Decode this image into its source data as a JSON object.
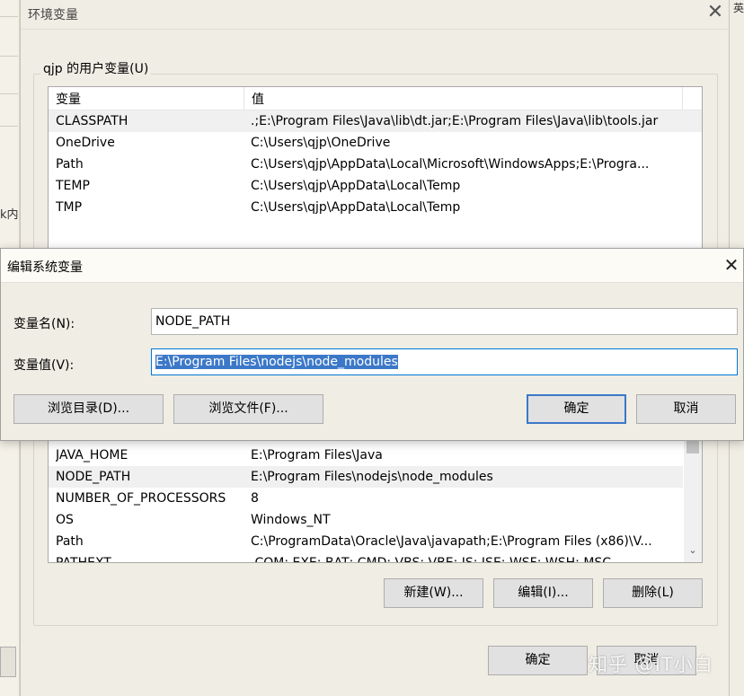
{
  "env_window": {
    "title": "环境变量",
    "user_group_label": "qjp 的用户变量(U)",
    "columns": [
      "变量",
      "值"
    ],
    "user_vars": [
      {
        "name": "CLASSPATH",
        "value": ".;E:\\Program Files\\Java\\lib\\dt.jar;E:\\Program Files\\Java\\lib\\tools.jar"
      },
      {
        "name": "OneDrive",
        "value": "C:\\Users\\qjp\\OneDrive"
      },
      {
        "name": "Path",
        "value": "C:\\Users\\qjp\\AppData\\Local\\Microsoft\\WindowsApps;E:\\Progra..."
      },
      {
        "name": "TEMP",
        "value": "C:\\Users\\qjp\\AppData\\Local\\Temp"
      },
      {
        "name": "TMP",
        "value": "C:\\Users\\qjp\\AppData\\Local\\Temp"
      }
    ],
    "system_vars": [
      {
        "name": "JAVA_HOME",
        "value": "E:\\Program Files\\Java"
      },
      {
        "name": "NODE_PATH",
        "value": "E:\\Program Files\\nodejs\\node_modules"
      },
      {
        "name": "NUMBER_OF_PROCESSORS",
        "value": "8"
      },
      {
        "name": "OS",
        "value": "Windows_NT"
      },
      {
        "name": "Path",
        "value": "C:\\ProgramData\\Oracle\\Java\\javapath;E:\\Program Files (x86)\\V..."
      },
      {
        "name": "PATHEXT",
        "value": ".COM;.EXE;.BAT;.CMD;.VBS;.VBE;.JS;.JSE;.WSF;.WSH;.MSC"
      }
    ],
    "buttons": {
      "new": "新建(W)...",
      "edit": "编辑(I)...",
      "delete": "删除(L)",
      "ok": "确定",
      "cancel": "取消"
    }
  },
  "edit_dialog": {
    "title": "编辑系统变量",
    "name_label": "变量名(N):",
    "name_value": "NODE_PATH",
    "value_label": "变量值(V):",
    "value_value": "E:\\Program Files\\nodejs\\node_modules",
    "buttons": {
      "browse_dir": "浏览目录(D)...",
      "browse_file": "浏览文件(F)...",
      "ok": "确定",
      "cancel": "取消"
    }
  },
  "background": {
    "left_text": "k内",
    "right_text": "英"
  },
  "watermark": "知乎 @IT小白"
}
